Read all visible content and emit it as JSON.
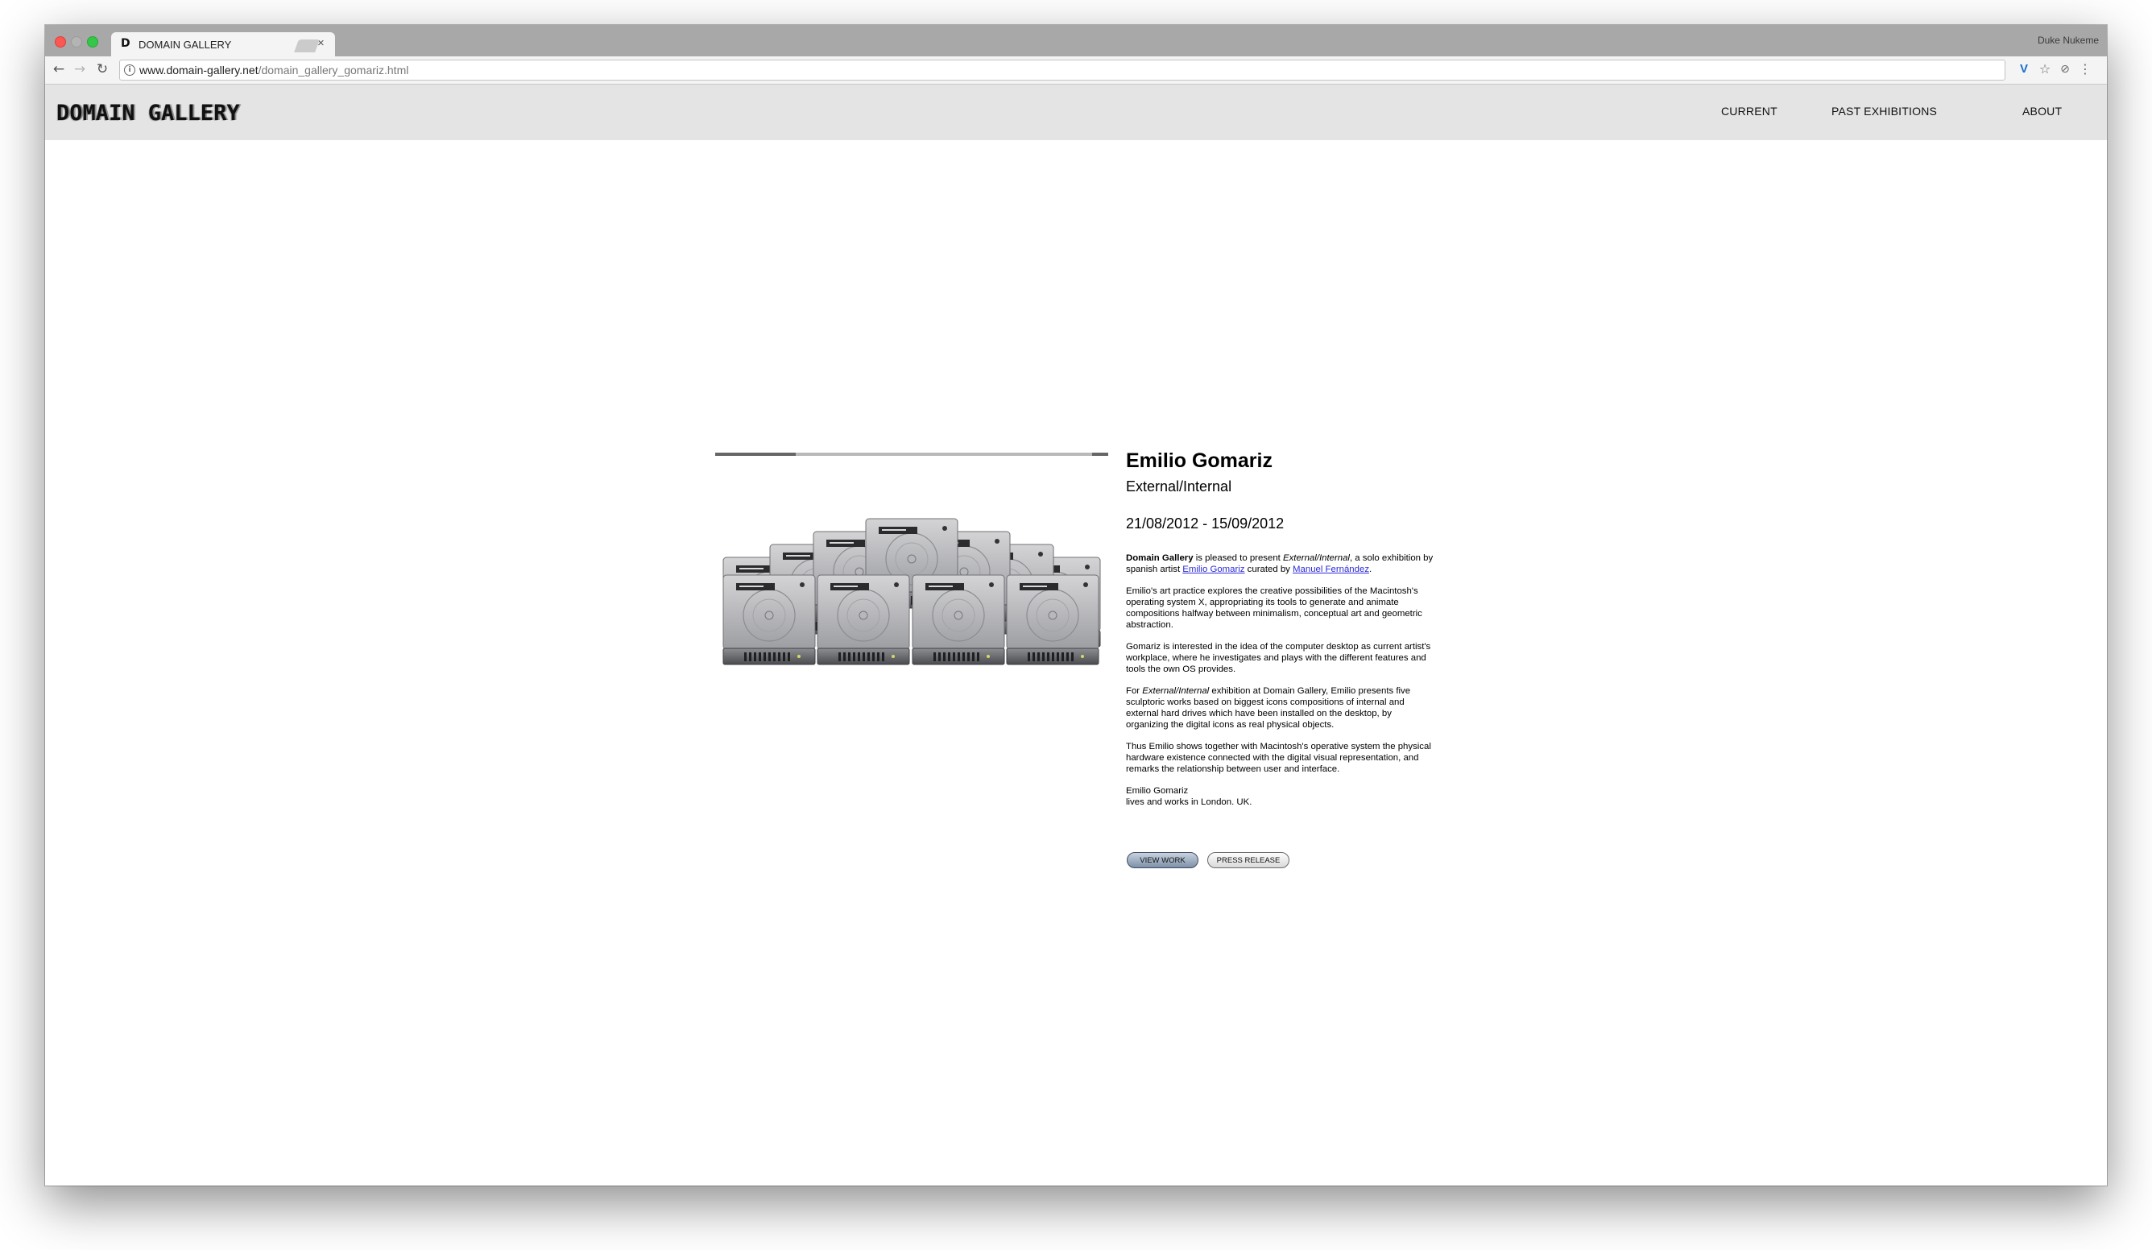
{
  "browser": {
    "tab_title": "DOMAIN GALLERY",
    "tab_favicon": "D",
    "tab_close": "×",
    "profile_name": "Duke Nukeme",
    "url_host": "www.domain-gallery.net",
    "url_path": "/domain_gallery_gomariz.html",
    "icons": {
      "back": "←",
      "forward": "→",
      "reload": "↻",
      "info": "i",
      "extension_v": "V",
      "star": "☆",
      "extension": "⊘",
      "menu": "⋮"
    }
  },
  "site": {
    "logo": "DOMAIN GALLERY",
    "nav": {
      "current": "CURRENT",
      "past_exhibitions": "PAST EXHIBITIONS",
      "about": "ABOUT"
    }
  },
  "exhibition": {
    "artist": "Emilio Gomariz",
    "title": "External/Internal",
    "dates": "21/08/2012 - 15/09/2012",
    "intro": {
      "gallery": "Domain Gallery",
      "t1": " is pleased to present ",
      "title_em": "External/Internal",
      "t2": ", a solo exhibition by spanish artist ",
      "artist_link": "Emilio Gomariz",
      "t3": " curated by ",
      "curator_link": "Manuel Fernández",
      "t4": "."
    },
    "para2": "Emilio's art practice explores the creative possibilities of the Macintosh's operating system X, appropriating its tools to generate and animate compositions halfway between minimalism, conceptual art and geometric abstraction.",
    "para3": "Gomariz is interested in the idea of the computer desktop as current artist's workplace, where he investigates and plays with the different features and tools the own OS provides.",
    "para4": {
      "t1": "For ",
      "title_em": "External/Internal",
      "t2": " exhibition at Domain Gallery, Emilio presents five sculptoric works based on biggest icons compositions of internal and external hard drives which have been installed on the desktop, by organizing the digital icons as real physical objects."
    },
    "para5": "Thus Emilio shows together with Macintosh's operative system the physical hardware existence connected with the digital visual representation, and remarks the relationship between user and interface.",
    "bio_name": "Emilio Gomariz",
    "bio_location": "lives and works in London. UK.",
    "buttons": {
      "view_work": "VIEW WORK",
      "press_release": "PRESS RELEASE"
    }
  },
  "colors": {
    "tabstrip": "#a8a8a8",
    "header_bg": "#e4e4e4",
    "link": "#2a2ad6",
    "view_button": "#7e90a8"
  }
}
